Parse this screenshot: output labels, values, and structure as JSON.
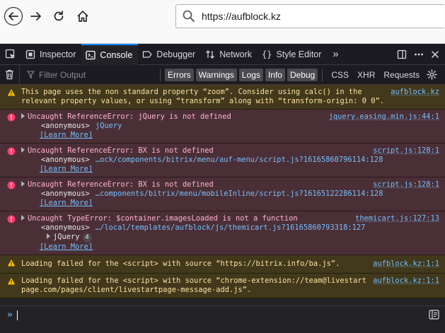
{
  "browser": {
    "url": "https://aufblock.kz"
  },
  "devtools": {
    "tabs": [
      "Inspector",
      "Console",
      "Debugger",
      "Network",
      "Style Editor"
    ],
    "active_tab": "Console",
    "more": "»"
  },
  "filterbar": {
    "placeholder": "Filter Output",
    "levels": [
      "Errors",
      "Warnings",
      "Logs",
      "Info",
      "Debug"
    ],
    "requests": [
      "CSS",
      "XHR",
      "Requests"
    ]
  },
  "messages": [
    {
      "type": "warn",
      "text": "This page uses the non standard property “zoom”. Consider using calc() in the relevant property values, or using “transform” along with “transform-origin: 0 0”.",
      "source": "aufblock.kz"
    },
    {
      "type": "err",
      "text": "Uncaught ReferenceError: jQuery is not defined",
      "source": "jquery.easing.min.js:44:1",
      "stack_fn": "<anonymous>",
      "stack_loc": "jQuery",
      "learn_more": "[Learn More]"
    },
    {
      "type": "err",
      "text": "Uncaught ReferenceError: BX is not defined",
      "source": "script.js:128:1",
      "stack_fn": "<anonymous>",
      "stack_loc": "…ock/components/bitrix/menu/auf-menu/script.js?16165860796114:128",
      "learn_more": "[Learn More]"
    },
    {
      "type": "err",
      "text": "Uncaught ReferenceError: BX is not defined",
      "source": "script.js:128:1",
      "stack_fn": "<anonymous>",
      "stack_loc": "…components/bitrix/menu/mobileInline/script.js?16165122286114:128",
      "learn_more": "[Learn More]"
    },
    {
      "type": "err",
      "text": "Uncaught TypeError: $container.imagesLoaded is not a function",
      "source": "themicart.js:127:13",
      "stack_fn": "<anonymous>",
      "stack_loc": "…/local/templates/aufblock/js/themicart.js?16165860793318:127",
      "sub_label": "jQuery",
      "sub_count": "4",
      "learn_more": "[Learn More]"
    },
    {
      "type": "warn",
      "text": "Loading failed for the <script> with source “https://bitrix.info/ba.js”.",
      "source": "aufblock.kz:1:1"
    },
    {
      "type": "warn",
      "text": "Loading failed for the <script> with source “chrome-extension://team@livestartpage.com/pages/client/livestartpage-message-add.js”.",
      "source": "aufblock.kz:1:1"
    }
  ],
  "input": {
    "prompt": "»"
  },
  "colors": {
    "accent": "#0a84ff",
    "link": "#75bfff",
    "error_bg": "#4b2f36",
    "warning_bg": "#42381b"
  }
}
